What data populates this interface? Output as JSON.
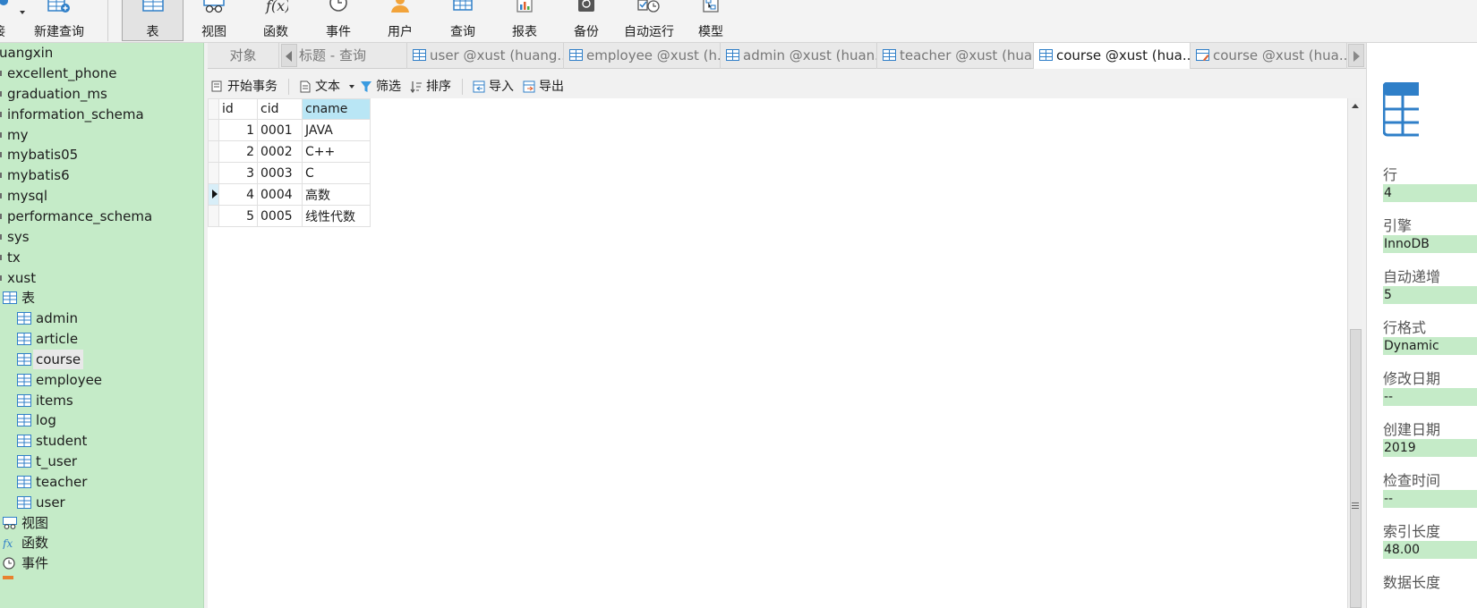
{
  "toolbar": {
    "items": [
      {
        "label": "接",
        "icon": "connection-icon"
      },
      {
        "label": "新建查询",
        "icon": "new-query-icon"
      },
      {
        "label": "表",
        "icon": "table-icon"
      },
      {
        "label": "视图",
        "icon": "view-icon"
      },
      {
        "label": "函数",
        "icon": "function-icon"
      },
      {
        "label": "事件",
        "icon": "event-icon"
      },
      {
        "label": "用户",
        "icon": "user-icon"
      },
      {
        "label": "查询",
        "icon": "query-icon"
      },
      {
        "label": "报表",
        "icon": "report-icon"
      },
      {
        "label": "备份",
        "icon": "backup-icon"
      },
      {
        "label": "自动运行",
        "icon": "auto-run-icon"
      },
      {
        "label": "模型",
        "icon": "model-icon"
      }
    ]
  },
  "sidebar": {
    "databases": [
      "uangxin",
      "excellent_phone",
      "graduation_ms",
      "information_schema",
      "my",
      "mybatis05",
      "mybatis6",
      "mysql",
      "performance_schema",
      "sys",
      "tx",
      "xust"
    ],
    "tables_group": "表",
    "tables": [
      "admin",
      "article",
      "course",
      "employee",
      "items",
      "log",
      "student",
      "t_user",
      "teacher",
      "user"
    ],
    "selected_table": "course",
    "views_group": "视图",
    "functions_group": "函数",
    "events_group": "事件"
  },
  "tabs": {
    "objects": "对象",
    "items": [
      {
        "label": "标题 - 查询",
        "icon": "none"
      },
      {
        "label": "user @xust (huang...",
        "icon": "table-icon"
      },
      {
        "label": "employee @xust (h...",
        "icon": "table-icon"
      },
      {
        "label": "admin @xust (huan...",
        "icon": "table-icon"
      },
      {
        "label": "teacher @xust (hua...",
        "icon": "table-icon"
      },
      {
        "label": "course @xust (hua...",
        "icon": "table-icon",
        "active": true
      },
      {
        "label": "course @xust (hua...",
        "icon": "table-design-icon"
      }
    ]
  },
  "subtoolbar": {
    "begin_transaction": "开始事务",
    "text": "文本",
    "filter": "筛选",
    "sort": "排序",
    "import": "导入",
    "export": "导出"
  },
  "grid": {
    "columns": [
      "id",
      "cid",
      "cname"
    ],
    "sorted_column": "cname",
    "rows": [
      {
        "id": "1",
        "cid": "0001",
        "cname": "JAVA"
      },
      {
        "id": "2",
        "cid": "0002",
        "cname": "C++"
      },
      {
        "id": "3",
        "cid": "0003",
        "cname": "C"
      },
      {
        "id": "4",
        "cid": "0004",
        "cname": "高数"
      },
      {
        "id": "5",
        "cid": "0005",
        "cname": "线性代数"
      }
    ],
    "current_row": 4
  },
  "info": {
    "fields": [
      {
        "label": "行",
        "value": "4"
      },
      {
        "label": "引擎",
        "value": "InnoDB"
      },
      {
        "label": "自动递增",
        "value": "5"
      },
      {
        "label": "行格式",
        "value": "Dynamic"
      },
      {
        "label": "修改日期",
        "value": "--"
      },
      {
        "label": "创建日期",
        "value": "2019"
      },
      {
        "label": "检查时间",
        "value": "--"
      },
      {
        "label": "索引长度",
        "value": "48.00"
      }
    ],
    "next_label": "数据长度"
  },
  "colors": {
    "sidebar_bg": "#c5ebc8",
    "sorted_header": "#b9e6f5",
    "active_tab": "#ffffff",
    "accent_blue": "#2f7fc8"
  }
}
